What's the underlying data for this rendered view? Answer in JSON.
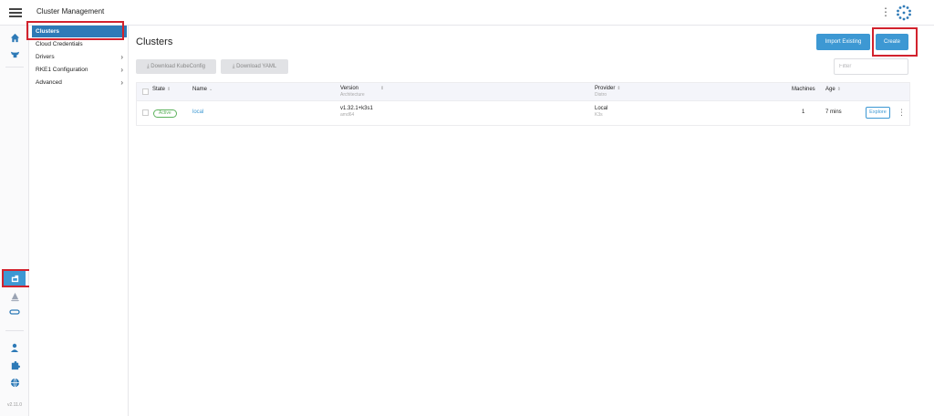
{
  "header": {
    "title": "Cluster Management"
  },
  "sidebar": {
    "items": [
      {
        "label": "Clusters",
        "chevron": ""
      },
      {
        "label": "Cloud Credentials",
        "chevron": ""
      },
      {
        "label": "Drivers",
        "chevron": "›"
      },
      {
        "label": "RKE1 Configuration",
        "chevron": "›"
      },
      {
        "label": "Advanced",
        "chevron": "›"
      }
    ]
  },
  "rail": {
    "version": "v2.11.0"
  },
  "main": {
    "title": "Clusters",
    "actions": {
      "import_existing": "Import Existing",
      "create": "Create"
    },
    "downloads": {
      "kubeconfig": "Download KubeConfig",
      "yaml": "Download YAML"
    },
    "filter": {
      "placeholder": "Filter"
    },
    "table": {
      "columns": {
        "state": "State",
        "name": "Name",
        "version": "Version",
        "version_sub": "Architecture",
        "provider": "Provider",
        "provider_sub": "Distro",
        "machines": "Machines",
        "age": "Age"
      },
      "rows": [
        {
          "state": "Active",
          "name": "local",
          "version": "v1.32.1+k3s1",
          "architecture": "amd64",
          "provider": "Local",
          "distro": "K3s",
          "machines": "1",
          "age": "7 mins",
          "action": "Explore"
        }
      ]
    }
  },
  "colors": {
    "accent": "#3d98d3",
    "active_nav": "#2e7ab7",
    "highlight": "#d2222d",
    "active_badge": "#5db25d"
  }
}
